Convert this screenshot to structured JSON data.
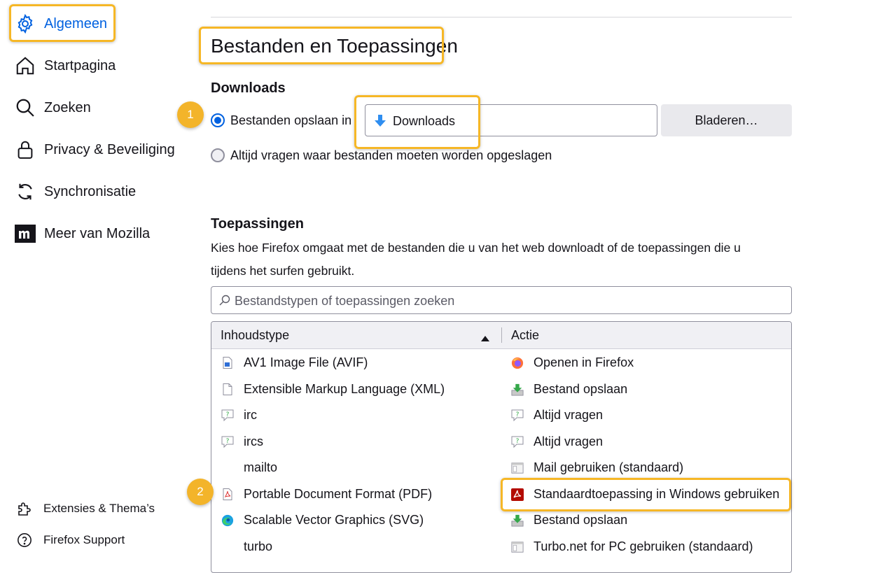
{
  "sidebar": {
    "items": [
      {
        "label": "Algemeen",
        "icon": "gear-icon",
        "active": true
      },
      {
        "label": "Startpagina",
        "icon": "home-icon"
      },
      {
        "label": "Zoeken",
        "icon": "search-icon"
      },
      {
        "label": "Privacy & Beveiliging",
        "icon": "lock-icon"
      },
      {
        "label": "Synchronisatie",
        "icon": "sync-icon"
      },
      {
        "label": "Meer van Mozilla",
        "icon": "mozilla-m-icon"
      }
    ],
    "footer": [
      {
        "label": "Extensies & Thema’s",
        "icon": "puzzle-icon"
      },
      {
        "label": "Firefox Support",
        "icon": "help-icon"
      }
    ]
  },
  "main": {
    "section_title": "Bestanden en Toepassingen",
    "downloads": {
      "heading": "Downloads",
      "save_in_label": "Bestanden opslaan in",
      "folder": "Downloads",
      "browse_button": "Bladeren…",
      "always_ask_label": "Altijd vragen waar bestanden moeten worden opgeslagen"
    },
    "applications": {
      "heading": "Toepassingen",
      "description_line1": "Kies hoe Firefox omgaat met de bestanden die u van het web downloadt of de toepassingen die u",
      "description_line2": "tijdens het surfen gebruikt.",
      "search_placeholder": "Bestandstypen of toepassingen zoeken",
      "columns": {
        "content_type": "Inhoudstype",
        "action": "Actie"
      },
      "rows": [
        {
          "type": "AV1 Image File (AVIF)",
          "type_icon": "image-file-icon",
          "action": "Openen in Firefox",
          "action_icon": "firefox-icon"
        },
        {
          "type": "Extensible Markup Language (XML)",
          "type_icon": "document-icon",
          "action": "Bestand opslaan",
          "action_icon": "save-download-icon"
        },
        {
          "type": "irc",
          "type_icon": "ask-bubble-icon",
          "action": "Altijd vragen",
          "action_icon": "ask-bubble-icon"
        },
        {
          "type": "ircs",
          "type_icon": "ask-bubble-icon",
          "action": "Altijd vragen",
          "action_icon": "ask-bubble-icon"
        },
        {
          "type": "mailto",
          "type_icon": "",
          "action": "Mail gebruiken (standaard)",
          "action_icon": "app-window-icon"
        },
        {
          "type": "Portable Document Format (PDF)",
          "type_icon": "pdf-file-icon",
          "action": "Standaardtoepassing in Windows gebruiken",
          "action_icon": "acrobat-icon"
        },
        {
          "type": "Scalable Vector Graphics (SVG)",
          "type_icon": "edge-icon",
          "action": "Bestand opslaan",
          "action_icon": "save-download-icon"
        },
        {
          "type": "turbo",
          "type_icon": "",
          "action": "Turbo.net for PC gebruiken (standaard)",
          "action_icon": "app-window-icon"
        }
      ]
    }
  },
  "annotations": {
    "badge_1": "1",
    "badge_2": "2"
  },
  "colors": {
    "accent": "#0061e0",
    "highlight": "#f6b726",
    "badge": "#f3b42a"
  }
}
